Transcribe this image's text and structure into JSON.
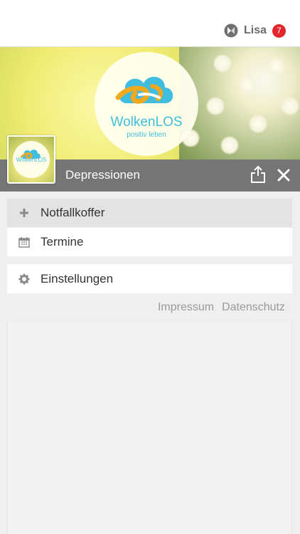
{
  "header": {
    "user_name": "Lisa",
    "notification_count": "7",
    "badge_color": "#e3262c"
  },
  "banner": {
    "logo_text": "WolkenLOS",
    "logo_subtitle": "positiv leben"
  },
  "thumbnail": {
    "text": "WolkenLOS"
  },
  "titlebar": {
    "title": "Depressionen",
    "share_icon": "share-icon",
    "close_icon": "close-icon"
  },
  "menu": [
    {
      "label": "Notfallkoffer",
      "icon": "plus-icon",
      "active": true
    },
    {
      "label": "Termine",
      "icon": "calendar-icon",
      "active": false
    },
    {
      "label": "Einstellungen",
      "icon": "gear-icon",
      "active": false
    }
  ],
  "footer": {
    "impressum": "Impressum",
    "datenschutz": "Datenschutz"
  },
  "colors": {
    "titlebar_bg": "#757575",
    "accent_blue": "#41bde0",
    "accent_orange": "#f0a91f"
  }
}
